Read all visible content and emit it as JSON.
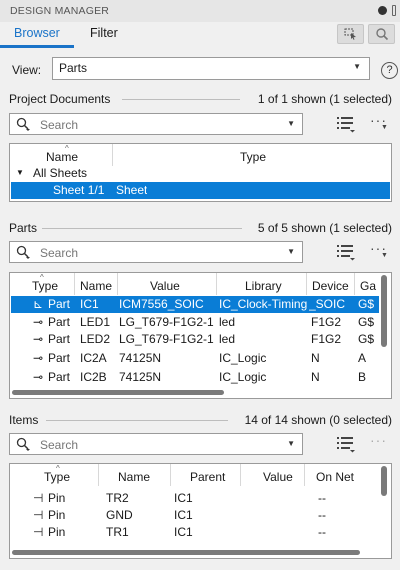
{
  "window": {
    "title": "DESIGN MANAGER"
  },
  "tabs": [
    {
      "label": "Browser",
      "active": true
    },
    {
      "label": "Filter",
      "active": false
    }
  ],
  "view": {
    "label": "View:",
    "value": "Parts"
  },
  "help_icon": "?",
  "project_documents": {
    "title": "Project Documents",
    "count": "1 of 1 shown (1 selected)",
    "search_placeholder": "Search",
    "columns": [
      "Name",
      "Type"
    ],
    "group": "All Sheets",
    "rows": [
      {
        "name": "Sheet 1/1",
        "type": "Sheet",
        "selected": true
      }
    ]
  },
  "parts": {
    "title": "Parts",
    "count": "5 of 5 shown (1 selected)",
    "search_placeholder": "Search",
    "columns": [
      "Type",
      "Name",
      "Value",
      "Library",
      "Device",
      "Ga"
    ],
    "rows": [
      {
        "type": "Part",
        "name": "IC1",
        "value": "ICM7556_SOIC",
        "library": "IC_Clock-Timing",
        "device": "_SOIC",
        "ga": "G$",
        "selected": true
      },
      {
        "type": "Part",
        "name": "LED1",
        "value": "LG_T679-F1G2-1",
        "library": "led",
        "device": "F1G2",
        "ga": "G$",
        "selected": false
      },
      {
        "type": "Part",
        "name": "LED2",
        "value": "LG_T679-F1G2-1",
        "library": "led",
        "device": "F1G2",
        "ga": "G$",
        "selected": false
      },
      {
        "type": "Part",
        "name": "IC2A",
        "value": "74125N",
        "library": "IC_Logic",
        "device": "N",
        "ga": "A",
        "selected": false
      },
      {
        "type": "Part",
        "name": "IC2B",
        "value": "74125N",
        "library": "IC_Logic",
        "device": "N",
        "ga": "B",
        "selected": false
      }
    ]
  },
  "items": {
    "title": "Items",
    "count": "14 of 14 shown (0 selected)",
    "search_placeholder": "Search",
    "columns": [
      "Type",
      "Name",
      "Parent",
      "Value",
      "On Net"
    ],
    "rows": [
      {
        "type": "Pin",
        "name": "TR2",
        "parent": "IC1",
        "value": "",
        "onnet": "--"
      },
      {
        "type": "Pin",
        "name": "GND",
        "parent": "IC1",
        "value": "",
        "onnet": "--"
      },
      {
        "type": "Pin",
        "name": "TR1",
        "parent": "IC1",
        "value": "",
        "onnet": "--"
      }
    ]
  },
  "colors": {
    "accent": "#1a73c8",
    "selection": "#0a7dd6"
  }
}
